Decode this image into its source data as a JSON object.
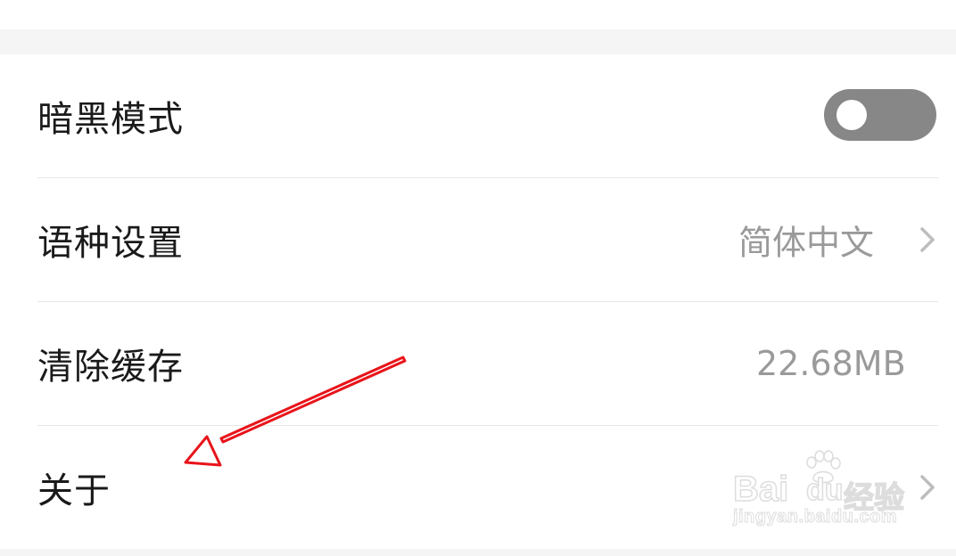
{
  "settings": {
    "rows": [
      {
        "label": "暗黑模式",
        "type": "toggle",
        "toggle_on": false
      },
      {
        "label": "语种设置",
        "value": "简体中文",
        "type": "link"
      },
      {
        "label": "清除缓存",
        "value": "22.68MB",
        "type": "value"
      },
      {
        "label": "关于",
        "type": "link"
      }
    ]
  },
  "watermark": {
    "brand": "Bai",
    "brand2": "du",
    "suffix": "经验",
    "url": "jingyan.baidu.com"
  },
  "colors": {
    "toggle_off": "#878787",
    "annotation_arrow": "#e8141a",
    "secondary_text": "#9a9a9a"
  },
  "icons": {
    "chevron": "chevron-right-icon",
    "annotation": "red-arrow-annotation"
  }
}
